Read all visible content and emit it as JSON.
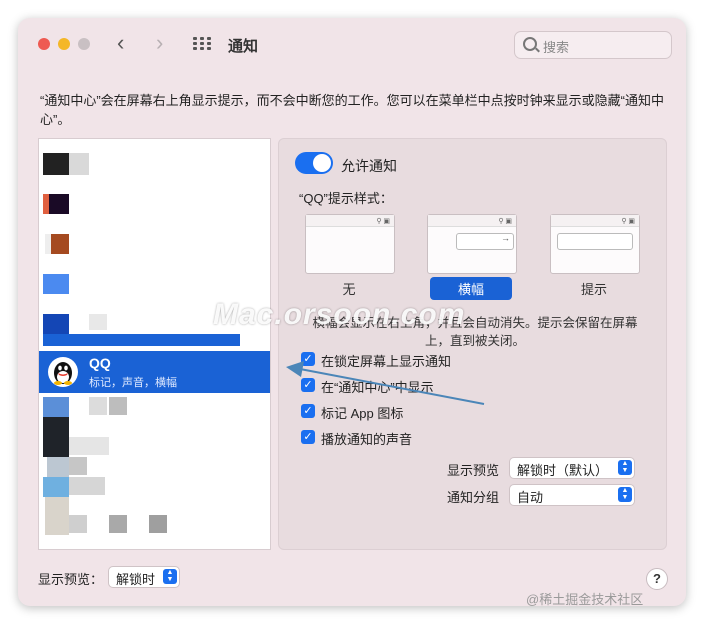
{
  "window": {
    "title": "通知",
    "search_placeholder": "搜索"
  },
  "description": "“通知中心”会在屏幕右上角显示提示，而不会中断您的工作。您可以在菜单栏中点按时钟来显示或隐藏“通知中心”。",
  "app_list": {
    "selected": {
      "name": "QQ",
      "subtitle": "标记，声音，横幅"
    }
  },
  "settings": {
    "allow_notifications_label": "允许通知",
    "allow_notifications": true,
    "style_label": "“QQ”提示样式：",
    "styles": [
      {
        "label": "无",
        "selected": false
      },
      {
        "label": "横幅",
        "selected": true
      },
      {
        "label": "提示",
        "selected": false
      }
    ],
    "style_info": "横幅会显示在右上角，并且会自动消失。提示会保留在屏幕上，直到被关闭。",
    "checkboxes": [
      {
        "label": "在锁定屏幕上显示通知",
        "checked": true
      },
      {
        "label": "在“通知中心”中显示",
        "checked": true
      },
      {
        "label": "标记 App 图标",
        "checked": true
      },
      {
        "label": "播放通知的声音",
        "checked": true
      }
    ],
    "preview_label": "显示预览",
    "preview_value": "解锁时（默认）",
    "grouping_label": "通知分组",
    "grouping_value": "自动"
  },
  "bottom": {
    "preview_label": "显示预览：",
    "preview_value": "解锁时",
    "help": "?"
  },
  "watermark": "Mac.orsoon.com",
  "credit": "@稀土掘金技术社区",
  "colors": {
    "accent": "#1a62d5",
    "window_bg": "#f1e4e8",
    "annotation_arrow": "#4b86b8"
  }
}
